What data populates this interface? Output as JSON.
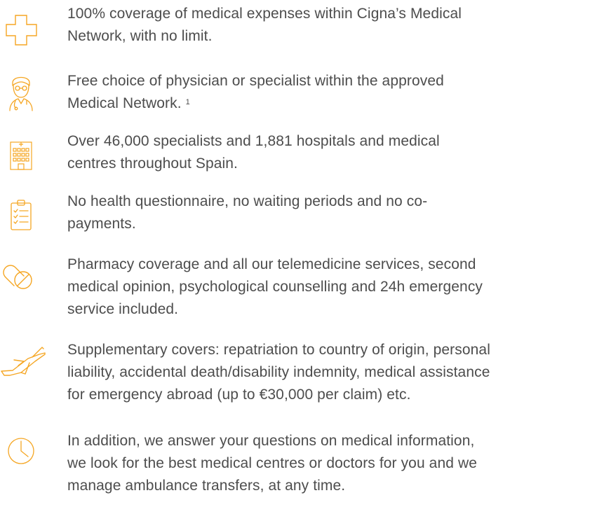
{
  "accent_color": "#f5a623",
  "items": [
    {
      "icon": "medical-cross-icon",
      "lines": [
        "100% coverage of medical expenses within Cigna’s Medical",
        "Network, with no limit."
      ]
    },
    {
      "icon": "doctor-icon",
      "lines": [
        "Free choice of physician or specialist within the approved",
        "Medical Network."
      ],
      "footnote": "1"
    },
    {
      "icon": "hospital-building-icon",
      "lines": [
        "Over 46,000 specialists and 1,881 hospitals and medical",
        "centres throughout Spain."
      ]
    },
    {
      "icon": "clipboard-checklist-icon",
      "lines": [
        "No health questionnaire, no waiting periods and no co-",
        "payments."
      ]
    },
    {
      "icon": "pills-icon",
      "lines": [
        "Pharmacy coverage and all our telemedicine services, second",
        "medical opinion, psychological counselling and 24h emergency",
        "service included."
      ]
    },
    {
      "icon": "airplane-icon",
      "lines": [
        "Supplementary covers: repatriation to country of origin, personal",
        "liability, accidental death/disability indemnity, medical assistance",
        "for emergency abroad (up to €30,000 per claim) etc."
      ]
    },
    {
      "icon": "clock-icon",
      "lines": [
        "In addition, we answer your questions on medical information,",
        "we look for the best medical centres or doctors for you and we",
        "manage ambulance transfers, at any time."
      ]
    }
  ]
}
